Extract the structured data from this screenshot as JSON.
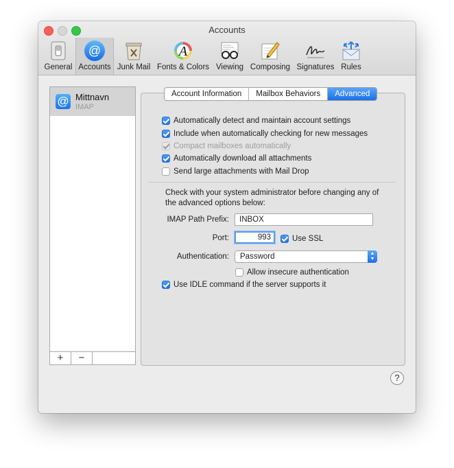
{
  "window": {
    "title": "Accounts"
  },
  "toolbar": {
    "items": [
      {
        "label": "General",
        "icon": "general-switch-icon"
      },
      {
        "label": "Accounts",
        "icon": "at-sign-icon"
      },
      {
        "label": "Junk Mail",
        "icon": "trash-bin-icon"
      },
      {
        "label": "Fonts & Colors",
        "icon": "font-a-icon"
      },
      {
        "label": "Viewing",
        "icon": "glasses-icon"
      },
      {
        "label": "Composing",
        "icon": "pencil-paper-icon"
      },
      {
        "label": "Signatures",
        "icon": "signature-icon"
      },
      {
        "label": "Rules",
        "icon": "rules-envelope-icon"
      }
    ],
    "selected": "Accounts"
  },
  "sidebar": {
    "accounts": [
      {
        "name": "Mittnavn",
        "type": "IMAP"
      }
    ],
    "add_label": "+",
    "remove_label": "−"
  },
  "tabs": [
    "Account Information",
    "Mailbox Behaviors",
    "Advanced"
  ],
  "active_tab": "Advanced",
  "options": [
    {
      "label": "Automatically detect and maintain account settings",
      "checked": true,
      "enabled": true
    },
    {
      "label": "Include when automatically checking for new messages",
      "checked": true,
      "enabled": true
    },
    {
      "label": "Compact mailboxes automatically",
      "checked": true,
      "enabled": false
    },
    {
      "label": "Automatically download all attachments",
      "checked": true,
      "enabled": true
    },
    {
      "label": "Send large attachments with Mail Drop",
      "checked": false,
      "enabled": true
    }
  ],
  "advanced": {
    "note": "Check with your system administrator before changing any of the advanced options below:",
    "imap_prefix_label": "IMAP Path Prefix:",
    "imap_prefix_value": "INBOX",
    "port_label": "Port:",
    "port_value": "993",
    "use_ssl_label": "Use SSL",
    "use_ssl": true,
    "auth_label": "Authentication:",
    "auth_value": "Password",
    "allow_insecure_label": "Allow insecure authentication",
    "allow_insecure": false,
    "idle_label": "Use IDLE command if the server supports it",
    "idle": true
  },
  "help_label": "?",
  "colors": {
    "accent": "#1c6fe6",
    "close": "#fc605c",
    "zoom": "#34c84a"
  }
}
